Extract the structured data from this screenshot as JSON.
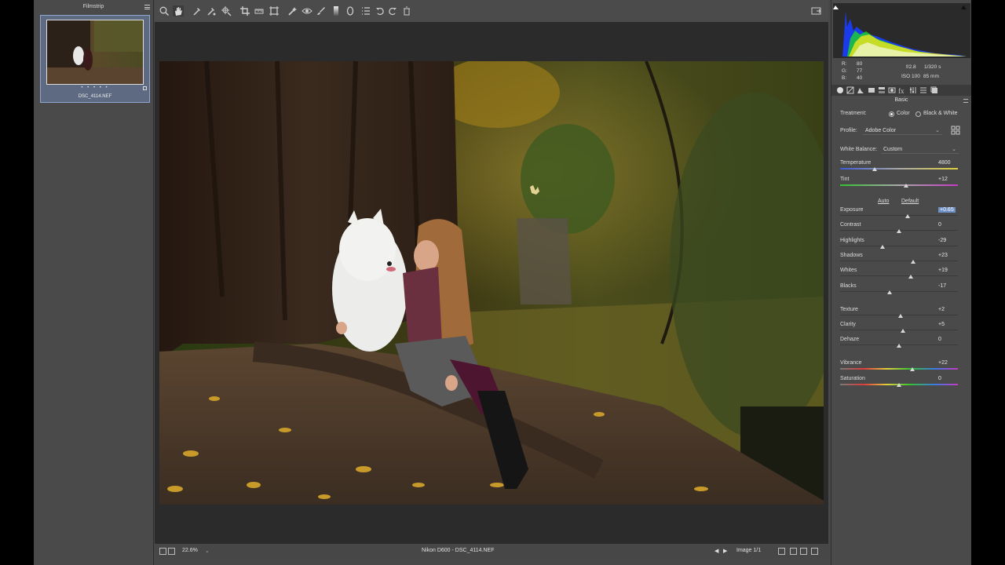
{
  "filmstrip": {
    "title": "Filmstrip",
    "thumbnail": {
      "filename": "DSC_4114.NEF",
      "rating": "• • • • •"
    }
  },
  "toolbar": {
    "tools": [
      "zoom-icon",
      "hand-icon",
      "white-balance-icon",
      "color-sampler-icon",
      "targeted-adjustment-icon",
      "crop-icon",
      "straighten-icon",
      "transform-icon",
      "spot-removal-icon",
      "red-eye-icon",
      "adjustment-brush-icon",
      "graduated-filter-icon",
      "radial-filter-icon",
      "preferences-icon",
      "rotate-left-icon",
      "rotate-right-icon",
      "trash-icon"
    ],
    "active_tool": "hand-icon"
  },
  "bottombar": {
    "zoom": "22.6%",
    "file_label": "Nikon D600  -  DSC_4114.NEF",
    "image_counter": "Image 1/1"
  },
  "histogram": {
    "r_label": "R:",
    "r_value": "80",
    "g_label": "G:",
    "g_value": "77",
    "b_label": "B:",
    "b_value": "40",
    "aperture": "f/2.8",
    "shutter": "1/320 s",
    "iso": "ISO 100",
    "focal": "85 mm"
  },
  "panel": {
    "title": "Basic",
    "treatment_label": "Treatment:",
    "treatment_color": "Color",
    "treatment_bw": "Black & White",
    "profile_label": "Profile:",
    "profile_value": "Adobe Color",
    "wb_label": "White Balance:",
    "wb_value": "Custom",
    "auto_label": "Auto",
    "default_label": "Default",
    "sliders": [
      {
        "label": "Temperature",
        "value": "4800",
        "pos": 0.29
      },
      {
        "label": "Tint",
        "value": "+12",
        "pos": 0.56
      },
      {
        "label": "Exposure",
        "value": "+0.65",
        "pos": 0.57
      },
      {
        "label": "Contrast",
        "value": "0",
        "pos": 0.5
      },
      {
        "label": "Highlights",
        "value": "-29",
        "pos": 0.36
      },
      {
        "label": "Shadows",
        "value": "+23",
        "pos": 0.62
      },
      {
        "label": "Whites",
        "value": "+19",
        "pos": 0.6
      },
      {
        "label": "Blacks",
        "value": "-17",
        "pos": 0.42
      },
      {
        "label": "Texture",
        "value": "+2",
        "pos": 0.51
      },
      {
        "label": "Clarity",
        "value": "+5",
        "pos": 0.53
      },
      {
        "label": "Dehaze",
        "value": "0",
        "pos": 0.5
      },
      {
        "label": "Vibrance",
        "value": "+22",
        "pos": 0.61
      },
      {
        "label": "Saturation",
        "value": "0",
        "pos": 0.5
      }
    ]
  },
  "colors": {
    "accent": "#6e8ec6",
    "panel_bg": "#4a4a4a",
    "canvas_bg": "#2b2b2b"
  }
}
